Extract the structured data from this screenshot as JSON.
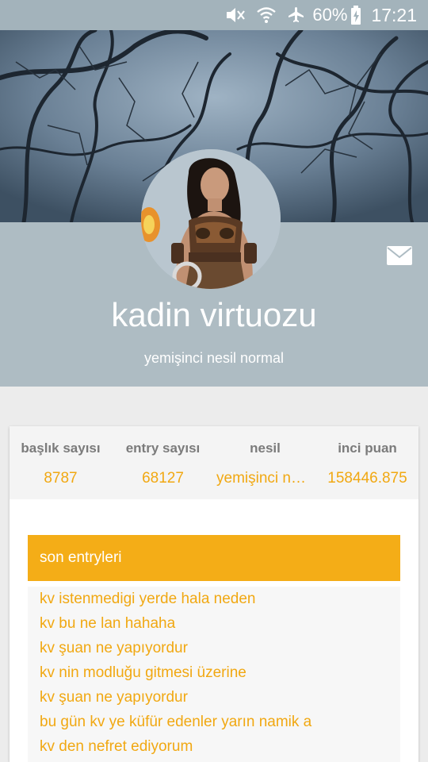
{
  "status_bar": {
    "icons": [
      "mute-icon",
      "wifi-icon",
      "airplane-icon",
      "battery-charging-icon"
    ],
    "battery": "60%",
    "time": "17:21"
  },
  "profile": {
    "username": "kadin virtuozu",
    "subtitle": "yemişinci nesil normal"
  },
  "stats": [
    {
      "label": "başlık sayısı",
      "value": "8787"
    },
    {
      "label": "entry sayısı",
      "value": "68127"
    },
    {
      "label": "nesil",
      "value": "yemişinci nes..."
    },
    {
      "label": "inci puan",
      "value": "158446.875"
    }
  ],
  "entries": {
    "header": "son entryleri",
    "items": [
      "kv istenmedigi yerde hala neden",
      "kv bu ne lan hahaha",
      "kv şuan ne yapıyordur",
      "kv nin modluğu gitmesi üzerine",
      "kv şuan ne yapıyordur",
      "bu gün kv ye küfür edenler yarın namik a",
      "kv den nefret ediyorum"
    ]
  },
  "colors": {
    "accent": "#f4ad17",
    "accent_text": "#f1a812",
    "profile_band": "#aebcc3",
    "status_bar": "#a3b3bb"
  }
}
